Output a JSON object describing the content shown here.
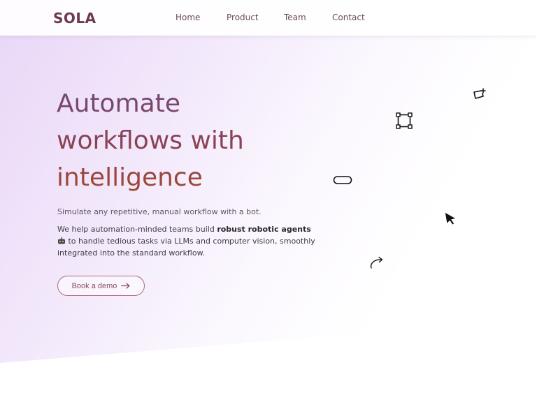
{
  "brand": {
    "logo_text": "SOLA"
  },
  "nav": {
    "links": [
      {
        "label": "Home"
      },
      {
        "label": "Product"
      },
      {
        "label": "Team"
      },
      {
        "label": "Contact"
      }
    ]
  },
  "hero": {
    "headline": [
      "Automate",
      "workflows with",
      "intelligence"
    ],
    "tagline": "Simulate any repetitive, manual workflow with a bot.",
    "description": {
      "before": "We help automation-minded teams build ",
      "bold": "robust robotic agents",
      "after": " to handle tedious tasks via LLMs and computer vision, smoothly integrated into the standard workflow."
    },
    "cta_label": "Book a demo"
  },
  "decorations": [
    "sparkle-frame-icon",
    "selection-box-icon",
    "pill-shape-icon",
    "cursor-arrow-icon",
    "curved-arrow-icon"
  ],
  "colors": {
    "brand": "#6b3a52",
    "headline_top": "#6d4a78",
    "headline_bottom": "#a24a2f",
    "cta_border": "#b26b7e"
  }
}
